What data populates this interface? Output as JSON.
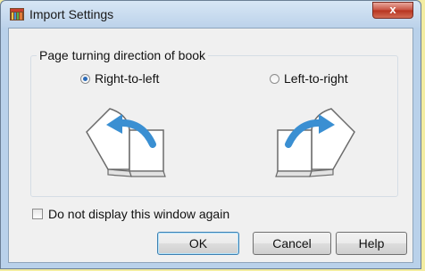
{
  "window": {
    "title": "Import Settings",
    "close_label": "x"
  },
  "group": {
    "legend": "Page turning direction of book",
    "options": [
      {
        "label": "Right-to-left",
        "checked": true
      },
      {
        "label": "Left-to-right",
        "checked": false
      }
    ]
  },
  "checkbox": {
    "label": "Do not display this window again",
    "checked": false
  },
  "buttons": {
    "ok": "OK",
    "cancel": "Cancel",
    "help": "Help"
  },
  "colors": {
    "arrow": "#3a8fd2",
    "title_bg": "#c9dcf0",
    "client_bg": "#f0f0f0"
  }
}
